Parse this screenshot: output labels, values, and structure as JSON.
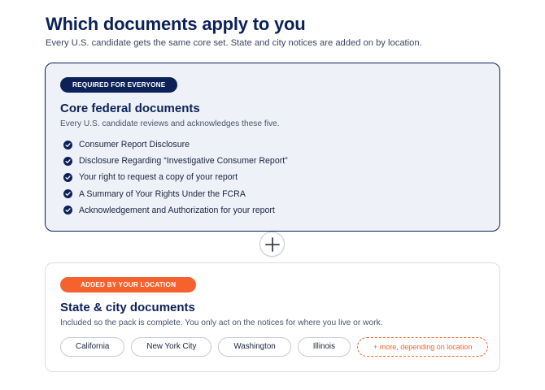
{
  "header": {
    "title": "Which documents apply to you",
    "subtitle": "Every U.S. candidate gets the same core set. State and city notices are added on by location."
  },
  "federal": {
    "badge": "REQUIRED FOR EVERYONE",
    "title": "Core federal documents",
    "description": "Every U.S. candidate reviews and acknowledges these five.",
    "documents": [
      "Consumer Report Disclosure",
      "Disclosure Regarding “Investigative Consumer Report”",
      "Your right to request a copy of your report",
      "A Summary of Your Rights Under the FCRA",
      "Acknowledgement and Authorization for your report"
    ],
    "check_icon": "check-circle-icon"
  },
  "connector": {
    "icon": "plus-icon"
  },
  "location": {
    "badge": "ADDED BY YOUR LOCATION",
    "title": "State & city documents",
    "description": "Included so the pack is complete. You only act on the notices for where you live or work.",
    "chips": [
      "California",
      "New York City",
      "Washington",
      "Illinois"
    ],
    "more_chip": "+ more, depending on location"
  },
  "colors": {
    "navy": "#0c2157",
    "accent_orange": "#f5622d",
    "federal_card_bg": "#eef1f7"
  }
}
